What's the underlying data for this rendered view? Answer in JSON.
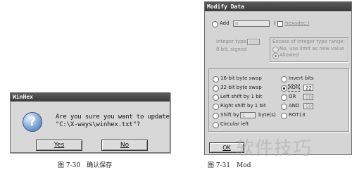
{
  "winhex_dialog": {
    "title": "WinHex",
    "message_line1": "Are you sure you want to update",
    "message_line2": "\"C:\\X-ways\\winhex.txt\"?",
    "yes_label": "Yes",
    "no_label": "No"
  },
  "modify_dialog": {
    "title": "Modify Data",
    "add_label": "Add",
    "add_value": "0",
    "hexadec_label": "hexadec.)",
    "integer_type_label": "Integer type:",
    "integer_type_value": "8 bit, signed",
    "excess_label": "Excess of integer type range:",
    "excess_option1": "No, use limit as new value",
    "excess_option2": "Allowed",
    "ops_left": [
      "16-bit byte swap",
      "32-bit byte swap",
      "Left shift by 1 bit",
      "Right shift by 1 bit",
      "Shift by",
      "Circular left"
    ],
    "shift_value": "1",
    "shift_unit": "byte(s)",
    "ops_right": [
      "Invert bits",
      "XOR",
      "OR",
      "AND",
      "ROT13"
    ],
    "xor_value": "22",
    "or_value": "00",
    "and_value": "00",
    "ok_label": "OK"
  },
  "captions": {
    "fig1": "图 7-30　确认保存",
    "fig2": "图 7-31　Mod"
  },
  "watermark": "软件技巧",
  "colors": {
    "titlebar": "#3b3b3b",
    "dialog_bg": "#d6d6d6"
  }
}
